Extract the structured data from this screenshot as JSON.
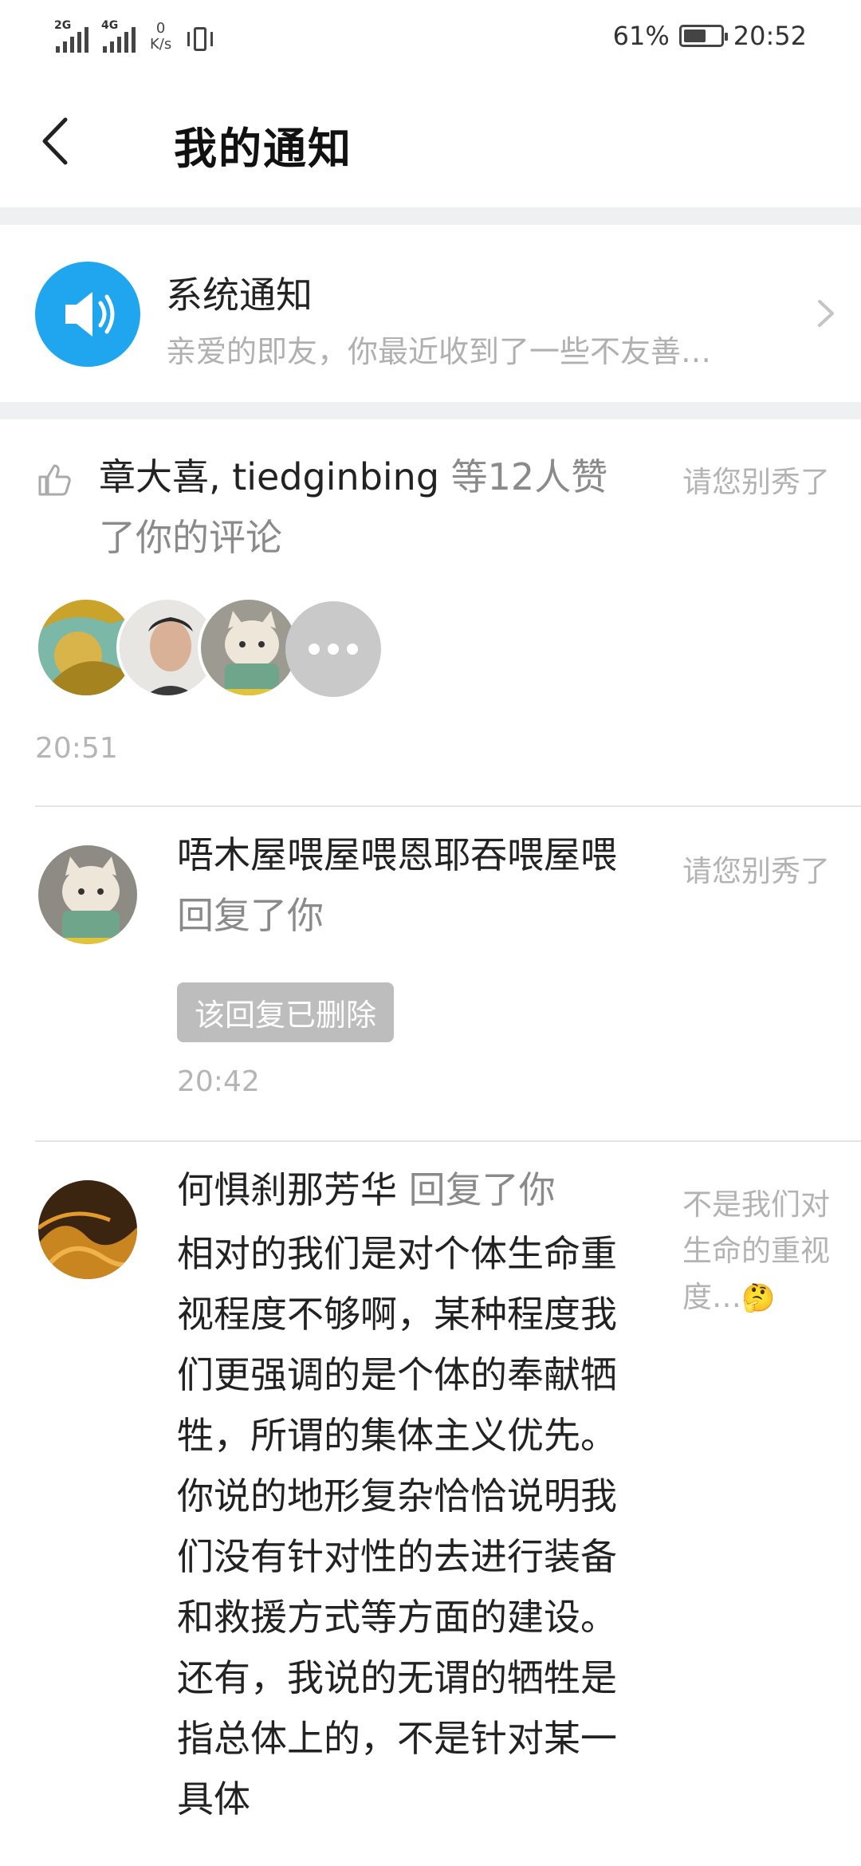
{
  "status_bar": {
    "signal1": "2G",
    "signal2": "4G",
    "net_speed_value": "0",
    "net_speed_unit": "K/s",
    "battery_percent": "61%",
    "battery_level": 0.61,
    "time": "20:52"
  },
  "header": {
    "title": "我的通知"
  },
  "system_notice": {
    "title": "系统通知",
    "preview": "亲爱的即友，你最近收到了一些不友善…"
  },
  "notifications": [
    {
      "type": "like",
      "users": "章大喜, tiedginbing",
      "action": "等12人赞了你的评论",
      "ref": "请您别秀了",
      "time": "20:51"
    },
    {
      "type": "reply",
      "user": "唔木屋喂屋喂恩耶吞喂屋喂",
      "action": "回复了你",
      "deleted_label": "该回复已删除",
      "ref": "请您别秀了",
      "time": "20:42"
    },
    {
      "type": "reply",
      "user": "何惧刹那芳华",
      "action": "回复了你",
      "body": "相对的我们是对个体生命重视程度不够啊，某种程度我们更强调的是个体的奉献牺牲，所谓的集体主义优先。你说的地形复杂恰恰说明我们没有针对性的去进行装备和救援方式等方面的建设。还有，我说的无谓的牺牲是指总体上的，不是针对某一具体",
      "ref": "不是我们对生命的重视度…",
      "ref_emoji": "🤔"
    }
  ],
  "icons": {
    "back": "chevron-left-icon",
    "speaker": "speaker-icon",
    "chevron": "chevron-right-icon",
    "like": "thumbs-up-icon",
    "more": "more-dots-icon"
  },
  "colors": {
    "accent": "#1fa6ee",
    "grey_text": "#8a8a8a",
    "light_text": "#b3b3b3"
  }
}
